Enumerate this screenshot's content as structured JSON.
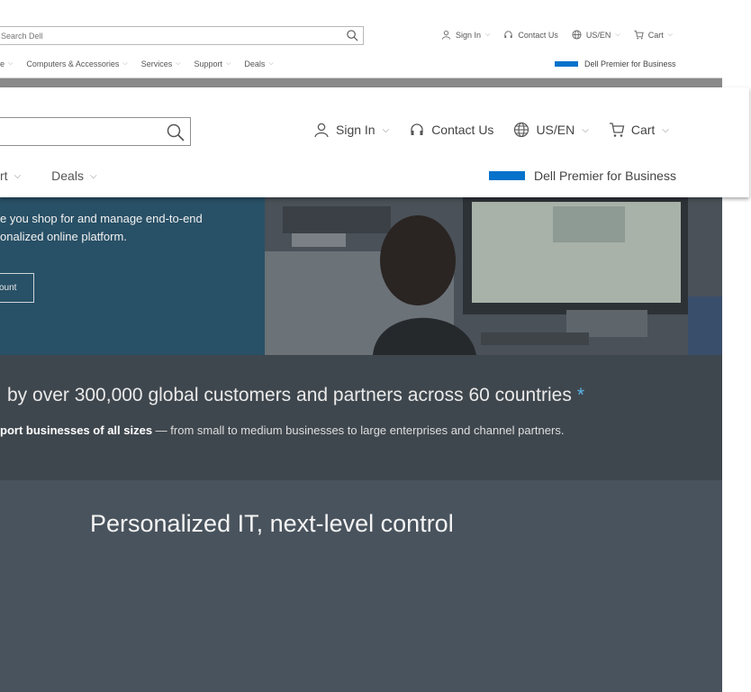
{
  "background_header": {
    "search_placeholder": "Search Dell",
    "utilities": [
      {
        "label": "Sign In",
        "icon": "user-icon"
      },
      {
        "label": "Contact Us",
        "icon": "headset-icon"
      },
      {
        "label": "US/EN",
        "icon": "globe-icon"
      },
      {
        "label": "Cart",
        "icon": "cart-icon"
      }
    ],
    "nav": [
      "e",
      "Computers & Accessories",
      "Services",
      "Support",
      "Deals"
    ],
    "premier_label": "Dell Premier for Business"
  },
  "overlay_header": {
    "search_placeholder": "",
    "utilities": [
      {
        "label": "Sign In",
        "icon": "user-icon"
      },
      {
        "label": "Contact Us",
        "icon": "headset-icon"
      },
      {
        "label": "US/EN",
        "icon": "globe-icon"
      },
      {
        "label": "Cart",
        "icon": "cart-icon"
      }
    ],
    "nav": [
      "rt",
      "Deals"
    ],
    "premier_label": "Dell Premier for Business"
  },
  "hero": {
    "line1": "e you shop for and manage end-to-end",
    "line2": "onalized online platform.",
    "button_label": "ount"
  },
  "stats": {
    "title": "by over 300,000 global customers and partners across 60 countries",
    "asterisk": "*",
    "sub_bold": "port businesses of all sizes",
    "sub_rest": " — from small to medium businesses to large enterprises and channel partners."
  },
  "personalized": {
    "title": "Personalized IT, next-level control"
  },
  "colors": {
    "brand_blue": "#0672cb",
    "hero_blue": "#285066",
    "stats_bg": "#3f474e",
    "personal_bg": "#49535d"
  }
}
